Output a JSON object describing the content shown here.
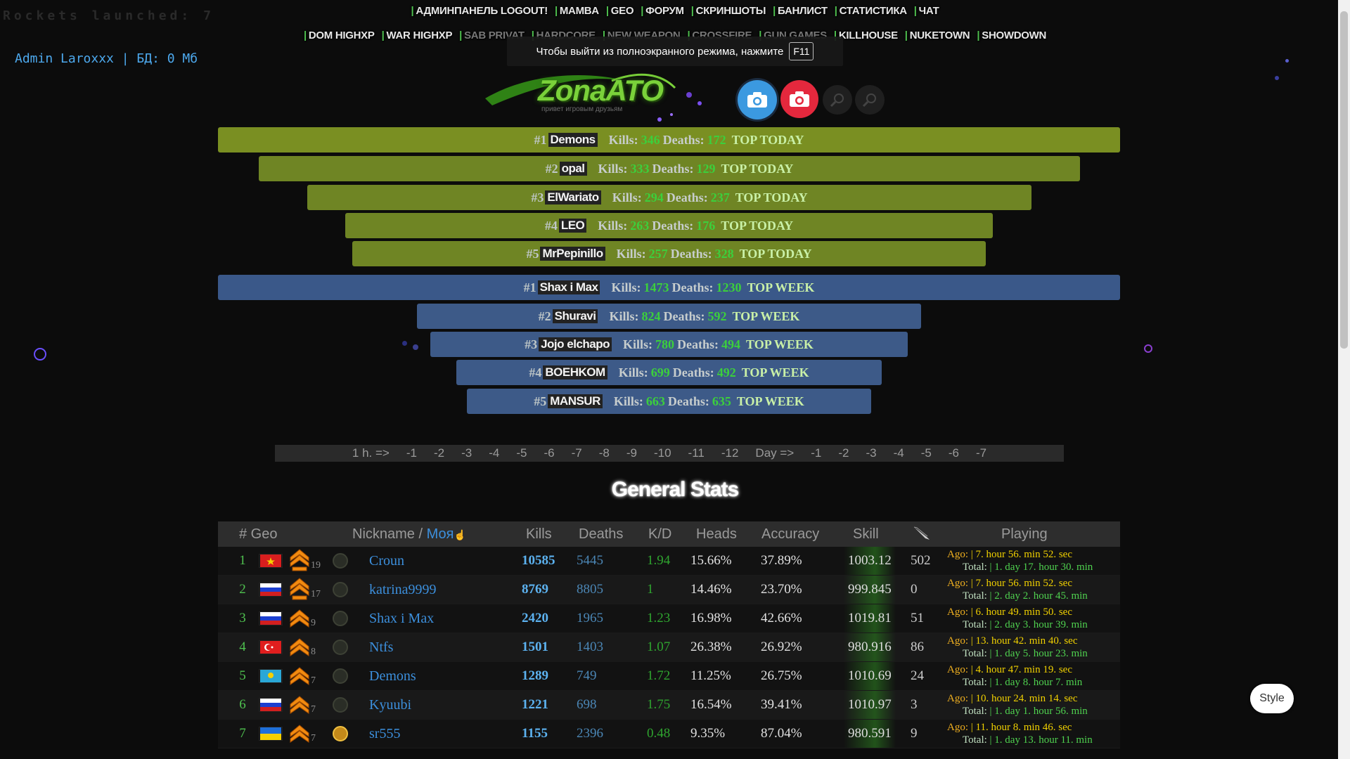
{
  "rockets": "Rockets launched: 7",
  "admin_line": "Admin Laroxxx | БД: 0 Мб",
  "fullscreen_hint": {
    "text": "Чтобы выйти из полноэкранного режима, нажмите",
    "key": "F11"
  },
  "menu": {
    "row1": [
      "АДМИНПАНЕЛЬ LOGOUT!",
      "MAMBA",
      "GEO",
      "ФОРУМ",
      "СКРИНШОТЫ",
      "БАНЛИСТ",
      "СТАТИСТИКА",
      "ЧАТ"
    ],
    "row2": [
      "DOM HIGHXP",
      "WAR HIGHXP",
      "SAB PRIVAT",
      "HARDCORE",
      "NEW WEAPON",
      "CROSSFIRE",
      "GUN GAMES",
      "KILLHOUSE",
      "NUKETOWN",
      "SHOWDOWN"
    ]
  },
  "logo": {
    "text": "ZonaATO",
    "sub": "привет игровым друзьям"
  },
  "top_today": [
    {
      "rank": "#1",
      "name": "Demons",
      "kills": "346",
      "deaths": "172",
      "tag": "TOP TODAY"
    },
    {
      "rank": "#2",
      "name": "opal",
      "kills": "333",
      "deaths": "129",
      "tag": "TOP TODAY"
    },
    {
      "rank": "#3",
      "name": "ElWariato",
      "kills": "294",
      "deaths": "237",
      "tag": "TOP TODAY"
    },
    {
      "rank": "#4",
      "name": "LEO",
      "kills": "263",
      "deaths": "176",
      "tag": "TOP TODAY"
    },
    {
      "rank": "#5",
      "name": "MrPepinillo",
      "kills": "257",
      "deaths": "328",
      "tag": "TOP TODAY"
    }
  ],
  "top_week": [
    {
      "rank": "#1",
      "name": "Shax i Max",
      "kills": "1473",
      "deaths": "1230",
      "tag": "TOP WEEK"
    },
    {
      "rank": "#2",
      "name": "Shuravi",
      "kills": "824",
      "deaths": "592",
      "tag": "TOP WEEK"
    },
    {
      "rank": "#3",
      "name": "Jojo elchapo",
      "kills": "780",
      "deaths": "494",
      "tag": "TOP WEEK"
    },
    {
      "rank": "#4",
      "name": "BOEHKOM",
      "kills": "699",
      "deaths": "492",
      "tag": "TOP WEEK"
    },
    {
      "rank": "#5",
      "name": "MANSUR",
      "kills": "663",
      "deaths": "635",
      "tag": "TOP WEEK"
    }
  ],
  "labels": {
    "kills": "Kills:",
    "deaths": "Deaths:"
  },
  "time_nav": [
    "1 h. =>",
    "-1",
    "-2",
    "-3",
    "-4",
    "-5",
    "-6",
    "-7",
    "-8",
    "-9",
    "-10",
    "-11",
    "-12",
    "Day =>",
    "-1",
    "-2",
    "-3",
    "-4",
    "-5",
    "-6",
    "-7"
  ],
  "general_title": "General Stats",
  "table_headers": {
    "num_geo": "# Geo",
    "nickname": "Nickname / ",
    "my": "Моя",
    "kills": "Kills",
    "deaths": "Deaths",
    "kd": "K/D",
    "heads": "Heads",
    "accuracy": "Accuracy",
    "skill": "Skill",
    "playing": "Playing"
  },
  "players": [
    {
      "num": "1",
      "flag": "vn",
      "rank": "19",
      "name": "Croun",
      "kills": "10585",
      "deaths": "5445",
      "kd": "1.94",
      "heads": "15.66%",
      "acc": "37.89%",
      "skill": "1003.12",
      "knife": "502",
      "ago": "7. hour 56. min 52. sec",
      "total": "1. day 17. hour 30. min"
    },
    {
      "num": "2",
      "flag": "ru",
      "rank": "17",
      "name": "katrina9999",
      "kills": "8769",
      "deaths": "8805",
      "kd": "1",
      "heads": "14.46%",
      "acc": "23.70%",
      "skill": "999.845",
      "knife": "0",
      "ago": "7. hour 56. min 52. sec",
      "total": "2. day 2. hour 45. min"
    },
    {
      "num": "3",
      "flag": "ru",
      "rank": "9",
      "name": "Shax i Max",
      "kills": "2420",
      "deaths": "1965",
      "kd": "1.23",
      "heads": "16.98%",
      "acc": "42.66%",
      "skill": "1019.81",
      "knife": "51",
      "ago": "6. hour 49. min 50. sec",
      "total": "2. day 3. hour 39. min"
    },
    {
      "num": "4",
      "flag": "tr",
      "rank": "8",
      "name": "Ntfs",
      "kills": "1501",
      "deaths": "1403",
      "kd": "1.07",
      "heads": "26.38%",
      "acc": "26.92%",
      "skill": "980.916",
      "knife": "86",
      "ago": "13. hour 42. min 40. sec",
      "total": "1. day 5. hour 23. min"
    },
    {
      "num": "5",
      "flag": "kz",
      "rank": "7",
      "name": "Demons",
      "kills": "1289",
      "deaths": "749",
      "kd": "1.72",
      "heads": "11.25%",
      "acc": "26.75%",
      "skill": "1010.69",
      "knife": "24",
      "ago": "4. hour 47. min 19. sec",
      "total": "1. day 8. hour 7. min"
    },
    {
      "num": "6",
      "flag": "ru",
      "rank": "7",
      "name": "Kyuubi",
      "kills": "1221",
      "deaths": "698",
      "kd": "1.75",
      "heads": "16.54%",
      "acc": "39.41%",
      "skill": "1010.97",
      "knife": "3",
      "ago": "10. hour 24. min 14. sec",
      "total": "1. day 1. hour 56. min"
    },
    {
      "num": "7",
      "flag": "ua",
      "rank": "7",
      "name": "sr555",
      "kills": "1155",
      "deaths": "2396",
      "kd": "0.48",
      "heads": "9.35%",
      "acc": "87.04%",
      "skill": "980.591",
      "knife": "9",
      "ago": "11. hour 8. min 46. sec",
      "total": "1. day 13. hour 11. min"
    }
  ],
  "play_labels": {
    "ago": "Ago:",
    "total": "Total:"
  },
  "style_button": "Style"
}
